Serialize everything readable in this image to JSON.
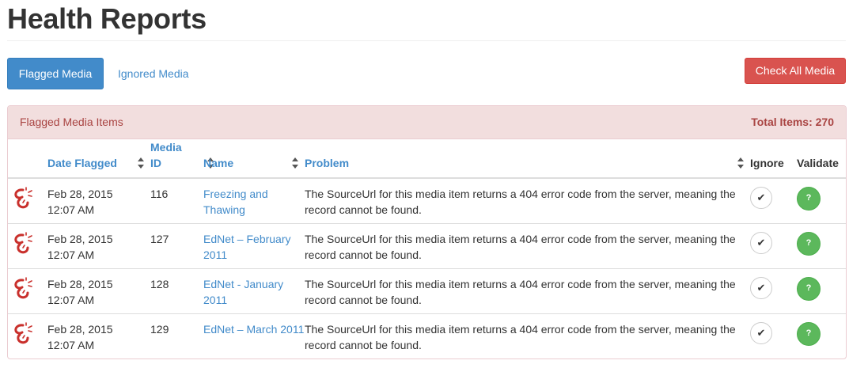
{
  "page": {
    "title": "Health Reports"
  },
  "toolbar": {
    "flagged_tab": "Flagged Media",
    "ignored_tab": "Ignored Media",
    "check_all": "Check All Media"
  },
  "panel": {
    "title": "Flagged Media Items",
    "total": "Total Items: 270"
  },
  "table": {
    "columns": {
      "date": "Date Flagged",
      "media_id": "Media ID",
      "name": "Name",
      "problem": "Problem",
      "ignore": "Ignore",
      "validate": "Validate"
    },
    "ignore_glyph": "✔",
    "validate_glyph": "?",
    "rows": [
      {
        "date": "Feb 28, 2015",
        "time": "12:07 AM",
        "id": "116",
        "name": "Freezing and Thawing",
        "problem": "The SourceUrl for this media item returns a 404 error code from the server, meaning the record cannot be found."
      },
      {
        "date": "Feb 28, 2015",
        "time": "12:07 AM",
        "id": "127",
        "name": "EdNet – February 2011",
        "problem": "The SourceUrl for this media item returns a 404 error code from the server, meaning the record cannot be found."
      },
      {
        "date": "Feb 28, 2015",
        "time": "12:07 AM",
        "id": "128",
        "name": "EdNet - January 2011",
        "problem": "The SourceUrl for this media item returns a 404 error code from the server, meaning the record cannot be found."
      },
      {
        "date": "Feb 28, 2015",
        "time": "12:07 AM",
        "id": "129",
        "name": "EdNet – March 2011",
        "problem": "The SourceUrl for this media item returns a 404 error code from the server, meaning the record cannot be found."
      }
    ]
  },
  "colors": {
    "primary": "#428bca",
    "danger": "#d9534f",
    "success": "#5cb85c",
    "panel_heading_bg": "#f2dede",
    "panel_heading_text": "#a94442",
    "broken_link_icon": "#c9302c"
  },
  "icons": {
    "row_status": "broken-link-icon",
    "sort": "sort-icon"
  }
}
